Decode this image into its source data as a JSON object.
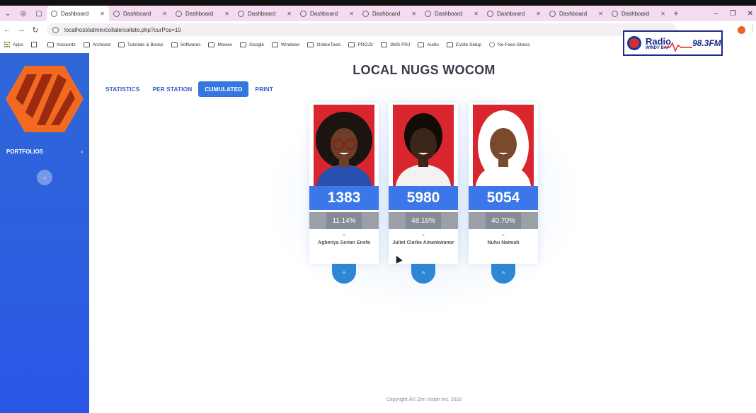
{
  "browser": {
    "tabs": [
      "Dashboard",
      "Dashboard",
      "Dashboard",
      "Dashboard",
      "Dashboard",
      "Dashboard",
      "Dashboard",
      "Dashboard",
      "Dashboard",
      "Dashboard"
    ],
    "active_tab": 0,
    "url": "localhost/admin/collate/collate.php?curPos=10",
    "bookmarks": [
      "Apps",
      "Accounts",
      "Archived",
      "Tutorials & Books",
      "Softwares",
      "Movies",
      "Google",
      "Windows",
      "OnlineTools",
      "PROJS",
      "SMS PRJ",
      "Audio",
      "EVote Setup",
      "No-Fees-Stress"
    ]
  },
  "radio": {
    "name": "Radio",
    "subtitle": "WINDY BAY",
    "frequency": "98.3FM"
  },
  "sidebar": {
    "menu_label": "PORTFOLIOS",
    "menu_chevron": "›",
    "collapse_glyph": "‹"
  },
  "page": {
    "title": "LOCAL NUGS WOCOM",
    "footer": "Copyright Â© Zim Vision inc. 2023"
  },
  "tabs": [
    {
      "label": "STATISTICS",
      "active": false
    },
    {
      "label": "PER STATION",
      "active": false
    },
    {
      "label": "CUMULATED",
      "active": true
    },
    {
      "label": "PRINT",
      "active": false
    }
  ],
  "candidates": [
    {
      "name": "Agbenya Serian Enefa",
      "votes": "1383",
      "percent": "11.14%",
      "percent_value": 11.14
    },
    {
      "name": "Juliet Clarke Amankwanor",
      "votes": "5980",
      "percent": "48.16%",
      "percent_value": 48.16
    },
    {
      "name": "Nuhu Naimah",
      "votes": "5054",
      "percent": "40.70%",
      "percent_value": 40.7
    }
  ],
  "colors": {
    "sidebar": "#2f67d8",
    "vote_band": "#3b77e8",
    "expand_button": "#2e86d6",
    "photo_background": "#d9252e",
    "logo_orange": "#f26a21"
  },
  "icons": {
    "card_chevron": "⌄",
    "expand": "^"
  }
}
